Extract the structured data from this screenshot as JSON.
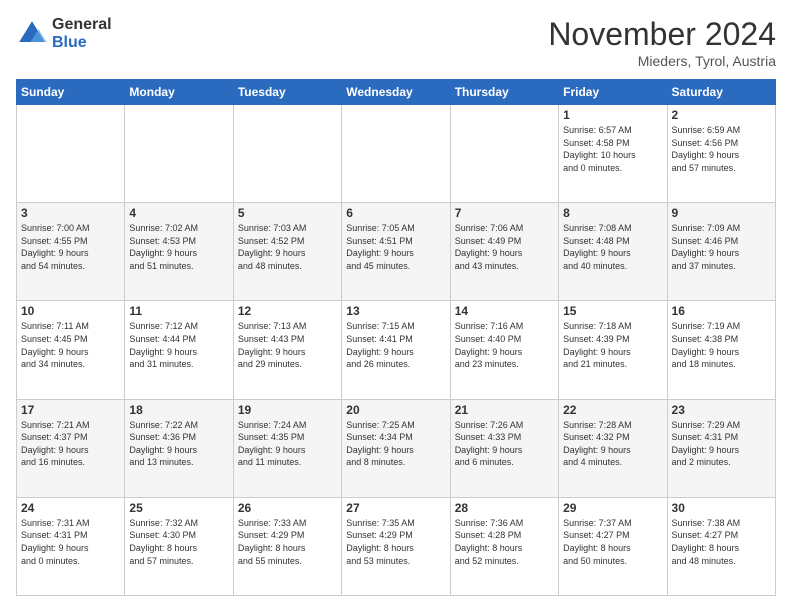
{
  "logo": {
    "general": "General",
    "blue": "Blue"
  },
  "header": {
    "title": "November 2024",
    "subtitle": "Mieders, Tyrol, Austria"
  },
  "days_of_week": [
    "Sunday",
    "Monday",
    "Tuesday",
    "Wednesday",
    "Thursday",
    "Friday",
    "Saturday"
  ],
  "weeks": [
    [
      {
        "day": "",
        "info": ""
      },
      {
        "day": "",
        "info": ""
      },
      {
        "day": "",
        "info": ""
      },
      {
        "day": "",
        "info": ""
      },
      {
        "day": "",
        "info": ""
      },
      {
        "day": "1",
        "info": "Sunrise: 6:57 AM\nSunset: 4:58 PM\nDaylight: 10 hours\nand 0 minutes."
      },
      {
        "day": "2",
        "info": "Sunrise: 6:59 AM\nSunset: 4:56 PM\nDaylight: 9 hours\nand 57 minutes."
      }
    ],
    [
      {
        "day": "3",
        "info": "Sunrise: 7:00 AM\nSunset: 4:55 PM\nDaylight: 9 hours\nand 54 minutes."
      },
      {
        "day": "4",
        "info": "Sunrise: 7:02 AM\nSunset: 4:53 PM\nDaylight: 9 hours\nand 51 minutes."
      },
      {
        "day": "5",
        "info": "Sunrise: 7:03 AM\nSunset: 4:52 PM\nDaylight: 9 hours\nand 48 minutes."
      },
      {
        "day": "6",
        "info": "Sunrise: 7:05 AM\nSunset: 4:51 PM\nDaylight: 9 hours\nand 45 minutes."
      },
      {
        "day": "7",
        "info": "Sunrise: 7:06 AM\nSunset: 4:49 PM\nDaylight: 9 hours\nand 43 minutes."
      },
      {
        "day": "8",
        "info": "Sunrise: 7:08 AM\nSunset: 4:48 PM\nDaylight: 9 hours\nand 40 minutes."
      },
      {
        "day": "9",
        "info": "Sunrise: 7:09 AM\nSunset: 4:46 PM\nDaylight: 9 hours\nand 37 minutes."
      }
    ],
    [
      {
        "day": "10",
        "info": "Sunrise: 7:11 AM\nSunset: 4:45 PM\nDaylight: 9 hours\nand 34 minutes."
      },
      {
        "day": "11",
        "info": "Sunrise: 7:12 AM\nSunset: 4:44 PM\nDaylight: 9 hours\nand 31 minutes."
      },
      {
        "day": "12",
        "info": "Sunrise: 7:13 AM\nSunset: 4:43 PM\nDaylight: 9 hours\nand 29 minutes."
      },
      {
        "day": "13",
        "info": "Sunrise: 7:15 AM\nSunset: 4:41 PM\nDaylight: 9 hours\nand 26 minutes."
      },
      {
        "day": "14",
        "info": "Sunrise: 7:16 AM\nSunset: 4:40 PM\nDaylight: 9 hours\nand 23 minutes."
      },
      {
        "day": "15",
        "info": "Sunrise: 7:18 AM\nSunset: 4:39 PM\nDaylight: 9 hours\nand 21 minutes."
      },
      {
        "day": "16",
        "info": "Sunrise: 7:19 AM\nSunset: 4:38 PM\nDaylight: 9 hours\nand 18 minutes."
      }
    ],
    [
      {
        "day": "17",
        "info": "Sunrise: 7:21 AM\nSunset: 4:37 PM\nDaylight: 9 hours\nand 16 minutes."
      },
      {
        "day": "18",
        "info": "Sunrise: 7:22 AM\nSunset: 4:36 PM\nDaylight: 9 hours\nand 13 minutes."
      },
      {
        "day": "19",
        "info": "Sunrise: 7:24 AM\nSunset: 4:35 PM\nDaylight: 9 hours\nand 11 minutes."
      },
      {
        "day": "20",
        "info": "Sunrise: 7:25 AM\nSunset: 4:34 PM\nDaylight: 9 hours\nand 8 minutes."
      },
      {
        "day": "21",
        "info": "Sunrise: 7:26 AM\nSunset: 4:33 PM\nDaylight: 9 hours\nand 6 minutes."
      },
      {
        "day": "22",
        "info": "Sunrise: 7:28 AM\nSunset: 4:32 PM\nDaylight: 9 hours\nand 4 minutes."
      },
      {
        "day": "23",
        "info": "Sunrise: 7:29 AM\nSunset: 4:31 PM\nDaylight: 9 hours\nand 2 minutes."
      }
    ],
    [
      {
        "day": "24",
        "info": "Sunrise: 7:31 AM\nSunset: 4:31 PM\nDaylight: 9 hours\nand 0 minutes."
      },
      {
        "day": "25",
        "info": "Sunrise: 7:32 AM\nSunset: 4:30 PM\nDaylight: 8 hours\nand 57 minutes."
      },
      {
        "day": "26",
        "info": "Sunrise: 7:33 AM\nSunset: 4:29 PM\nDaylight: 8 hours\nand 55 minutes."
      },
      {
        "day": "27",
        "info": "Sunrise: 7:35 AM\nSunset: 4:29 PM\nDaylight: 8 hours\nand 53 minutes."
      },
      {
        "day": "28",
        "info": "Sunrise: 7:36 AM\nSunset: 4:28 PM\nDaylight: 8 hours\nand 52 minutes."
      },
      {
        "day": "29",
        "info": "Sunrise: 7:37 AM\nSunset: 4:27 PM\nDaylight: 8 hours\nand 50 minutes."
      },
      {
        "day": "30",
        "info": "Sunrise: 7:38 AM\nSunset: 4:27 PM\nDaylight: 8 hours\nand 48 minutes."
      }
    ]
  ]
}
